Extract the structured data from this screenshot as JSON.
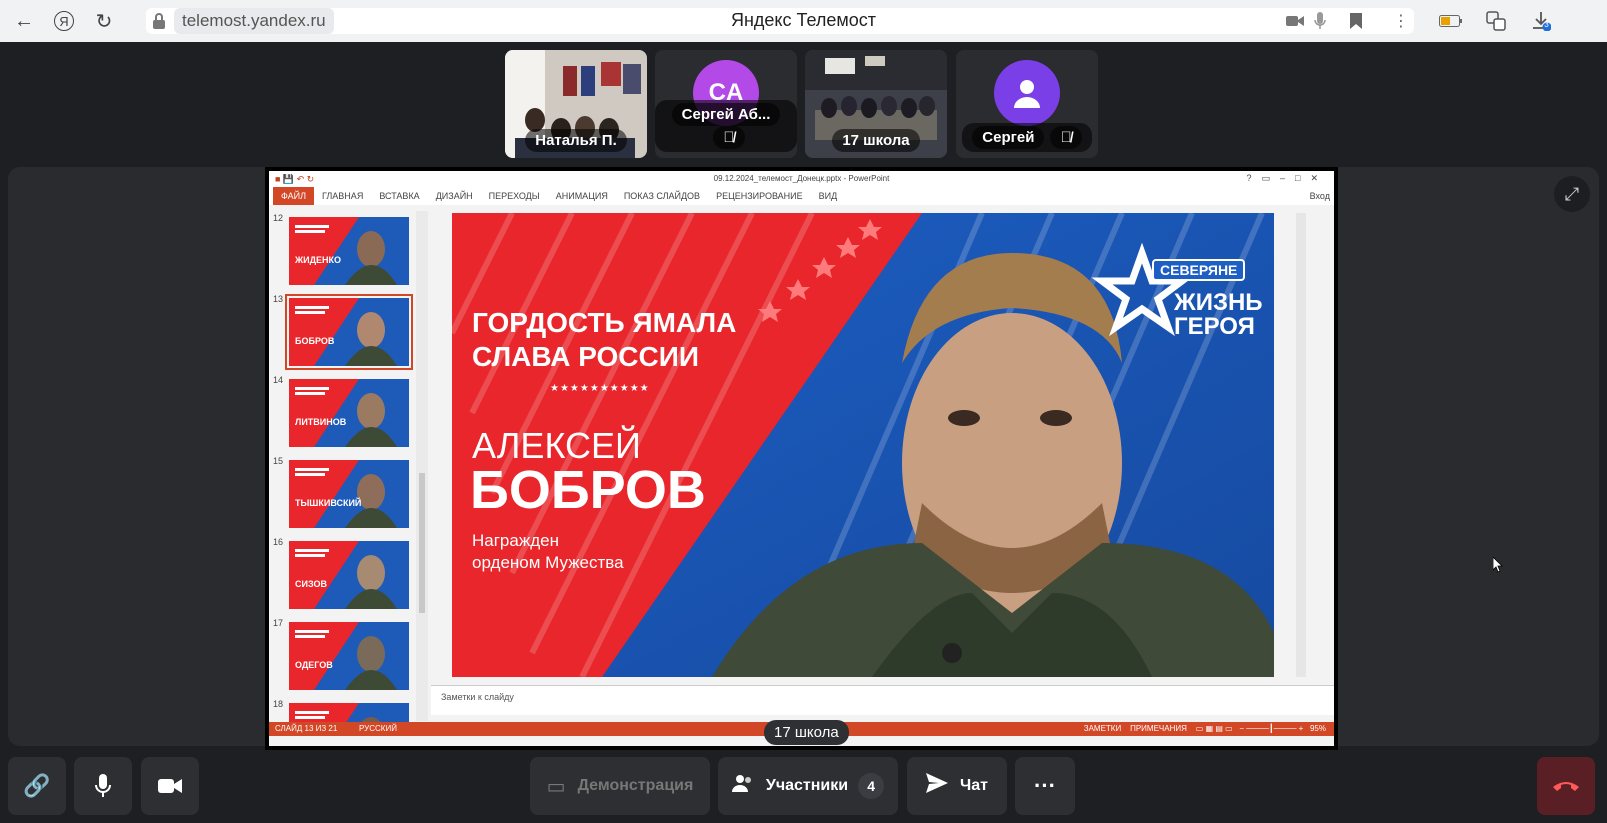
{
  "browser": {
    "url": "telemost.yandex.ru",
    "title": "Яндекс Телемост",
    "download_badge": "3"
  },
  "participants": [
    {
      "name": "Наталья П.",
      "type": "video"
    },
    {
      "name": "Сергей Аб...",
      "initials": "CA",
      "muted": true,
      "type": "avatar"
    },
    {
      "name": "17 школа",
      "type": "video"
    },
    {
      "name": "Сергей",
      "muted": true,
      "type": "avatar-person"
    }
  ],
  "ppt": {
    "title": "09.12.2024_телемост_Донецк.pptx - PowerPoint",
    "tabs": [
      "ФАЙЛ",
      "ГЛАВНАЯ",
      "ВСТАВКА",
      "ДИЗАЙН",
      "ПЕРЕХОДЫ",
      "АНИМАЦИЯ",
      "ПОКАЗ СЛАЙДОВ",
      "РЕЦЕНЗИРОВАНИЕ",
      "ВИД"
    ],
    "login": "Вход",
    "thumbs": [
      {
        "num": "12",
        "label": "ЖИДЕНКО"
      },
      {
        "num": "13",
        "label": "БОБРОВ",
        "selected": true
      },
      {
        "num": "14",
        "label": "ЛИТВИНОВ"
      },
      {
        "num": "15",
        "label": "ТЫШКИВСКИЙ"
      },
      {
        "num": "16",
        "label": "СИЗОВ"
      },
      {
        "num": "17",
        "label": "ОДЕГОВ"
      },
      {
        "num": "18",
        "label": ""
      }
    ],
    "slide": {
      "heading1": "ГОРДОСТЬ ЯМАЛА",
      "heading2": "СЛАВА РОССИИ",
      "stars": "★★★★★★★★★★",
      "first_name": "АЛЕКСЕЙ",
      "last_name": "БОБРОВ",
      "award1": "Награжден",
      "award2": "орденом Мужества",
      "brand_top": "СЕВЕРЯНЕ",
      "brand1": "ЖИЗНЬ",
      "brand2": "ГЕРОЯ"
    },
    "notes_placeholder": "Заметки к слайду",
    "status_slide": "СЛАЙД 13 ИЗ 21",
    "status_lang": "РУССКИЙ",
    "status_notes": "ЗАМЕТКИ",
    "status_comments": "ПРИМЕЧАНИЯ",
    "zoom": "95%"
  },
  "speaker_label": "17 школа",
  "toolbar": {
    "demo": "Демонстрация",
    "participants": "Участники",
    "participants_count": "4",
    "chat": "Чат",
    "more": "···"
  },
  "colors": {
    "accent_red": "#e8262b",
    "accent_blue": "#1e5bb8",
    "hangup": "#5a1f24"
  }
}
